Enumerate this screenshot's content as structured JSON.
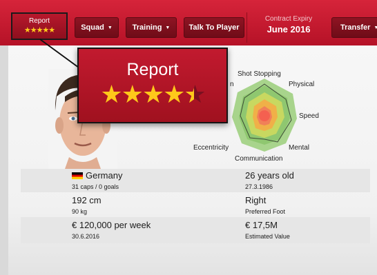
{
  "toolbar": {
    "report_label": "Report",
    "report_stars": "★★★★★",
    "squad_label": "Squad",
    "training_label": "Training",
    "talk_label": "Talk To Player",
    "contract_caption": "Contract Expiry",
    "contract_value": "June 2016",
    "transfer_label": "Transfer"
  },
  "report_popup": {
    "title": "Report",
    "star_rating": 4.5,
    "full_stars": "★★★★",
    "half_star": "★"
  },
  "attributes": {
    "shot_stopping": "Shot Stopping",
    "physical": "Physical",
    "speed": "Speed",
    "mental": "Mental",
    "communication": "Communication",
    "eccentricity": "Eccentricity",
    "partial_left": "n"
  },
  "player": {
    "nationality": "Germany",
    "caps": "31 caps / 0 goals",
    "age": "26 years old",
    "birth_date": "27.3.1986",
    "height": "192 cm",
    "weight": "90 kg",
    "foot": "Right",
    "foot_caption": "Preferred Foot",
    "wage": "€ 120,000 per week",
    "contract_end": "30.6.2016",
    "value": "€ 17,5M",
    "value_caption": "Estimated Value"
  },
  "colors": {
    "accent": "#c41e3a",
    "star": "#ffc81a"
  }
}
